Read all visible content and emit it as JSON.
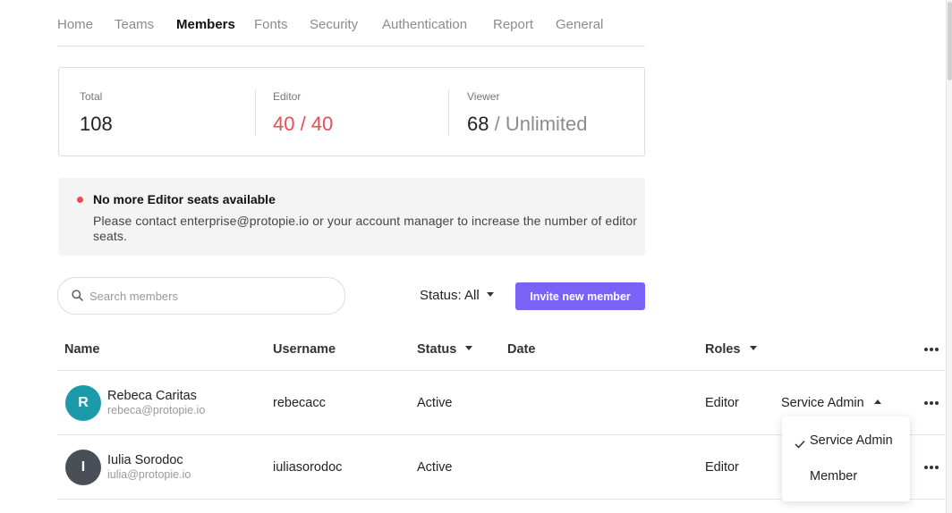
{
  "nav": {
    "items": [
      "Home",
      "Teams",
      "Members",
      "Fonts",
      "Security",
      "Authentication",
      "Report",
      "General"
    ],
    "active": "Members"
  },
  "stats": {
    "total": {
      "label": "Total",
      "value": "108"
    },
    "editor": {
      "label": "Editor",
      "value": "40 / 40",
      "color": "#ea4c57"
    },
    "viewer": {
      "label": "Viewer",
      "value": "68",
      "suffix": " / Unlimited"
    }
  },
  "alert": {
    "title": "No more Editor seats available",
    "body": "Please contact enterprise@protopie.io or your account manager to increase the number of editor seats.",
    "dot_color": "#ea4c57"
  },
  "search": {
    "placeholder": "Search members",
    "value": ""
  },
  "status_filter": {
    "label": "Status: All"
  },
  "invite_button": {
    "label": "Invite new member",
    "color": "#7b62f6"
  },
  "table": {
    "headers": {
      "name": "Name",
      "username": "Username",
      "status": "Status",
      "date": "Date",
      "roles": "Roles"
    },
    "rows": [
      {
        "initial": "R",
        "avatar_color": "#1b9aaa",
        "name": "Rebeca Caritas",
        "email": "rebeca@protopie.io",
        "username": "rebecacc",
        "status": "Active",
        "date": "",
        "role": "Editor",
        "admin_role": "Service Admin"
      },
      {
        "initial": "I",
        "avatar_color": "#4a4f57",
        "name": "Iulia Sorodoc",
        "email": "iulia@protopie.io",
        "username": "iuliasorodoc",
        "status": "Active",
        "date": "",
        "role": "Editor",
        "admin_role": ""
      }
    ]
  },
  "role_menu": {
    "options": [
      "Service Admin",
      "Member"
    ],
    "selected": "Service Admin"
  }
}
